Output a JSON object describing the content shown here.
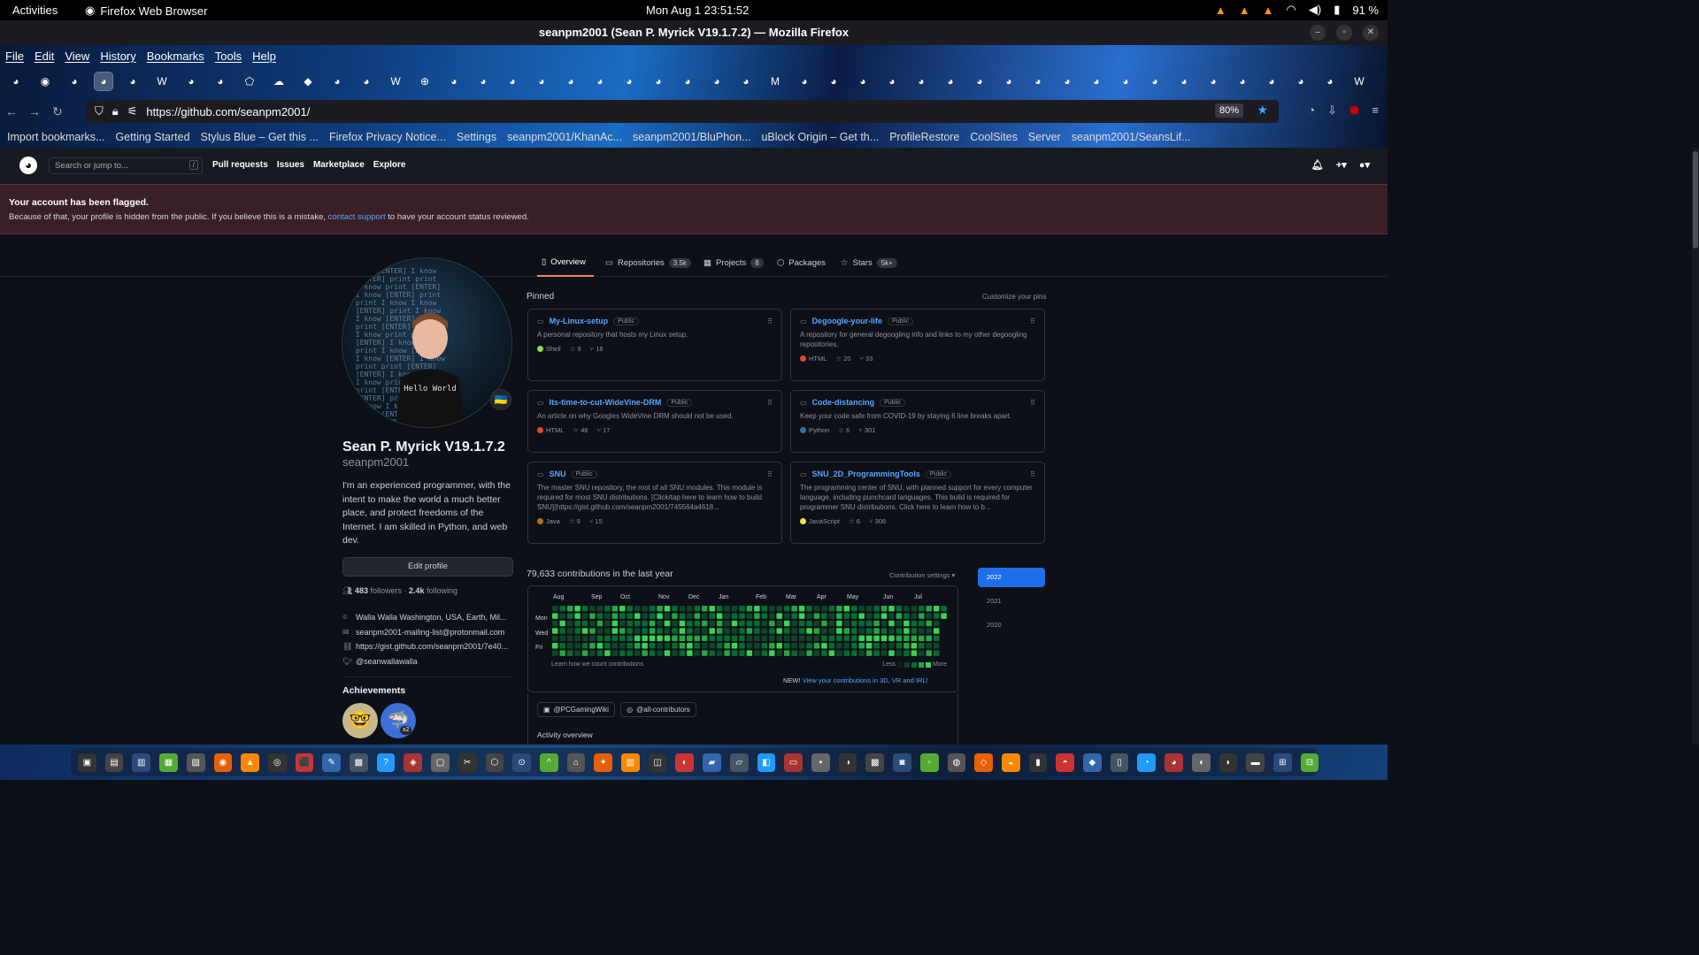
{
  "system": {
    "activities": "Activities",
    "app_name": "Firefox Web Browser",
    "clock": "Mon Aug 1  23:51:52",
    "battery": "91 %"
  },
  "window": {
    "title": "seanpm2001 (Sean P. Myrick V19.1.7.2) — Mozilla Firefox"
  },
  "menu": [
    "File",
    "Edit",
    "View",
    "History",
    "Bookmarks",
    "Tools",
    "Help"
  ],
  "url": "https://github.com/seanpm2001/",
  "zoom": "80%",
  "bookmarks": [
    "Import bookmarks...",
    "Getting Started",
    "Stylus Blue – Get this ...",
    "Firefox Privacy Notice...",
    "Settings",
    "seanpm2001/KhanAc...",
    "seanpm2001/BluPhon...",
    "uBlock Origin – Get th...",
    "ProfileRestore",
    "CoolSites",
    "Server",
    "seanpm2001/SeansLif..."
  ],
  "gh": {
    "search_placeholder": "Search or jump to...",
    "nav": [
      "Pull requests",
      "Issues",
      "Marketplace",
      "Explore"
    ]
  },
  "flag": {
    "title": "Your account has been flagged.",
    "text_before": "Because of that, your profile is hidden from the public. If you believe this is a mistake, ",
    "link": "contact support",
    "text_after": " to have your account status reviewed."
  },
  "tabs": [
    {
      "label": "Overview",
      "count": ""
    },
    {
      "label": "Repositories",
      "count": "3.5k"
    },
    {
      "label": "Projects",
      "count": "8"
    },
    {
      "label": "Packages",
      "count": ""
    },
    {
      "label": "Stars",
      "count": "5k+"
    }
  ],
  "profile": {
    "name": "Sean P. Myrick V19.1.7.2",
    "login": "seanpm2001",
    "bio": "I'm an experienced programmer, with the intent to make the world a much better place, and protect freedoms of the Internet. I am skilled in Python, and web dev.",
    "edit": "Edit profile",
    "followers": "483",
    "followers_label": "followers",
    "following": "2.4k",
    "following_label": "following",
    "location": "Walla Walla Washington, USA, Earth, Mil...",
    "email": "seanpm2001-mailing-list@protonmail.com",
    "website": "https://gist.github.com/seanpm2001/7e40...",
    "twitter": "@seanwallawalla",
    "achievements": "Achievements",
    "ach_badge": "x2"
  },
  "pinned": {
    "title": "Pinned",
    "customize": "Customize your pins",
    "repos": [
      {
        "name": "My-Linux-setup",
        "vis": "Public",
        "desc": "A personal repository that hosts my Linux setup.",
        "lang": "Shell",
        "color": "#89e051",
        "stars": "9",
        "forks": "18"
      },
      {
        "name": "Degoogle-your-life",
        "vis": "Public",
        "desc": "A repository for general degoogling info and links to my other degoogling repositories.",
        "lang": "HTML",
        "color": "#e34c26",
        "stars": "20",
        "forks": "33"
      },
      {
        "name": "Its-time-to-cut-WideVine-DRM",
        "vis": "Public",
        "desc": "An article on why Googles WideVine DRM should not be used.",
        "lang": "HTML",
        "color": "#e34c26",
        "stars": "46",
        "forks": "17"
      },
      {
        "name": "Code-distancing",
        "vis": "Public",
        "desc": "Keep your code safe from COVID-19 by staying 6 line breaks apart.",
        "lang": "Python",
        "color": "#3572A5",
        "stars": "6",
        "forks": "301"
      },
      {
        "name": "SNU",
        "vis": "Public",
        "desc": "The master SNU repository, the root of all SNU modules. This module is required for most SNU distributions. [Click/tap here to learn how to build SNU](https://gist.github.com/seanpm2001/745564a4618...",
        "lang": "Java",
        "color": "#b07219",
        "stars": "9",
        "forks": "15"
      },
      {
        "name": "SNU_2D_ProgrammingTools",
        "vis": "Public",
        "desc": "The programming center of SNU, with planned support for every computer language, including punchcard languages. This build is required for programmer SNU distributions. Click here to learn how to b...",
        "lang": "JavaScript",
        "color": "#f1e05a",
        "stars": "6",
        "forks": "308"
      }
    ]
  },
  "contrib": {
    "title": "79,633 contributions in the last year",
    "settings": "Contribution settings ▾",
    "months": [
      "Aug",
      "Sep",
      "Oct",
      "Nov",
      "Dec",
      "Jan",
      "Feb",
      "Mar",
      "Apr",
      "May",
      "Jun",
      "Jul"
    ],
    "days": [
      "Mon",
      "Wed",
      "Fri"
    ],
    "learn": "Learn how we count contributions",
    "less": "Less",
    "more": "More",
    "new_label": "NEW!",
    "new_link": "View your contributions in 3D, VR and IRL!",
    "years": [
      "2022",
      "2021",
      "2020"
    ]
  },
  "orgs": [
    "@PCGamingWiki",
    "@all-contributors"
  ],
  "activity": "Activity overview"
}
